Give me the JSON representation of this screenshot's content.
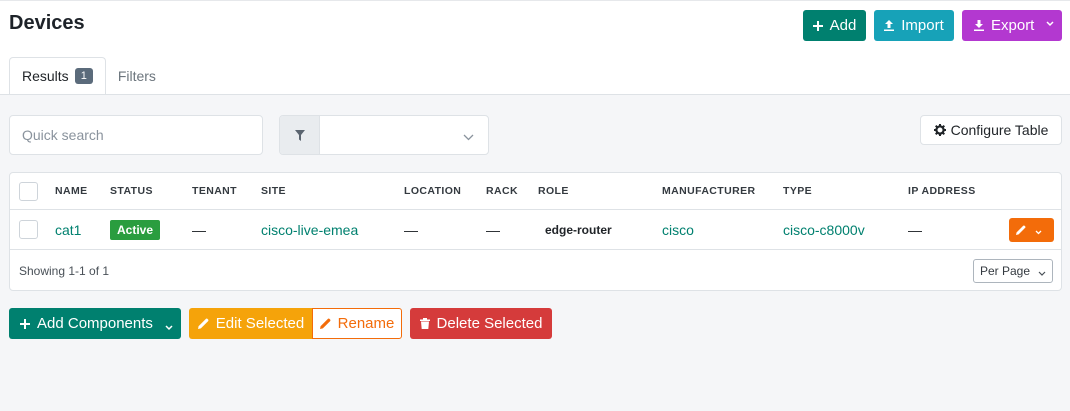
{
  "header": {
    "title": "Devices",
    "buttons": {
      "add": "Add",
      "import": "Import",
      "export": "Export"
    }
  },
  "tabs": [
    {
      "label": "Results",
      "badge": "1",
      "active": true
    },
    {
      "label": "Filters",
      "active": false
    }
  ],
  "toolbar": {
    "search_placeholder": "Quick search",
    "filter_value": "",
    "configure_table": "Configure Table"
  },
  "table": {
    "columns": [
      "NAME",
      "STATUS",
      "TENANT",
      "SITE",
      "LOCATION",
      "RACK",
      "ROLE",
      "MANUFACTURER",
      "TYPE",
      "IP ADDRESS"
    ],
    "rows": [
      {
        "name": "cat1",
        "status": "Active",
        "tenant": "—",
        "site": "cisco-live-emea",
        "location": "—",
        "rack": "—",
        "role": "edge-router",
        "manufacturer": "cisco",
        "type": "cisco-c8000v",
        "ip_address": "—"
      }
    ],
    "showing": "Showing 1-1 of 1",
    "per_page": "Per Page"
  },
  "bulk_actions": {
    "add_components": "Add Components",
    "edit_selected": "Edit Selected",
    "rename": "Rename",
    "delete_selected": "Delete Selected"
  },
  "colors": {
    "primary": "#00806f",
    "info": "#17a2b8",
    "export": "#b338d0",
    "warning": "#f5a30a",
    "orange": "#f36c0a",
    "danger": "#d53b3b",
    "success": "#2a9d3f"
  }
}
